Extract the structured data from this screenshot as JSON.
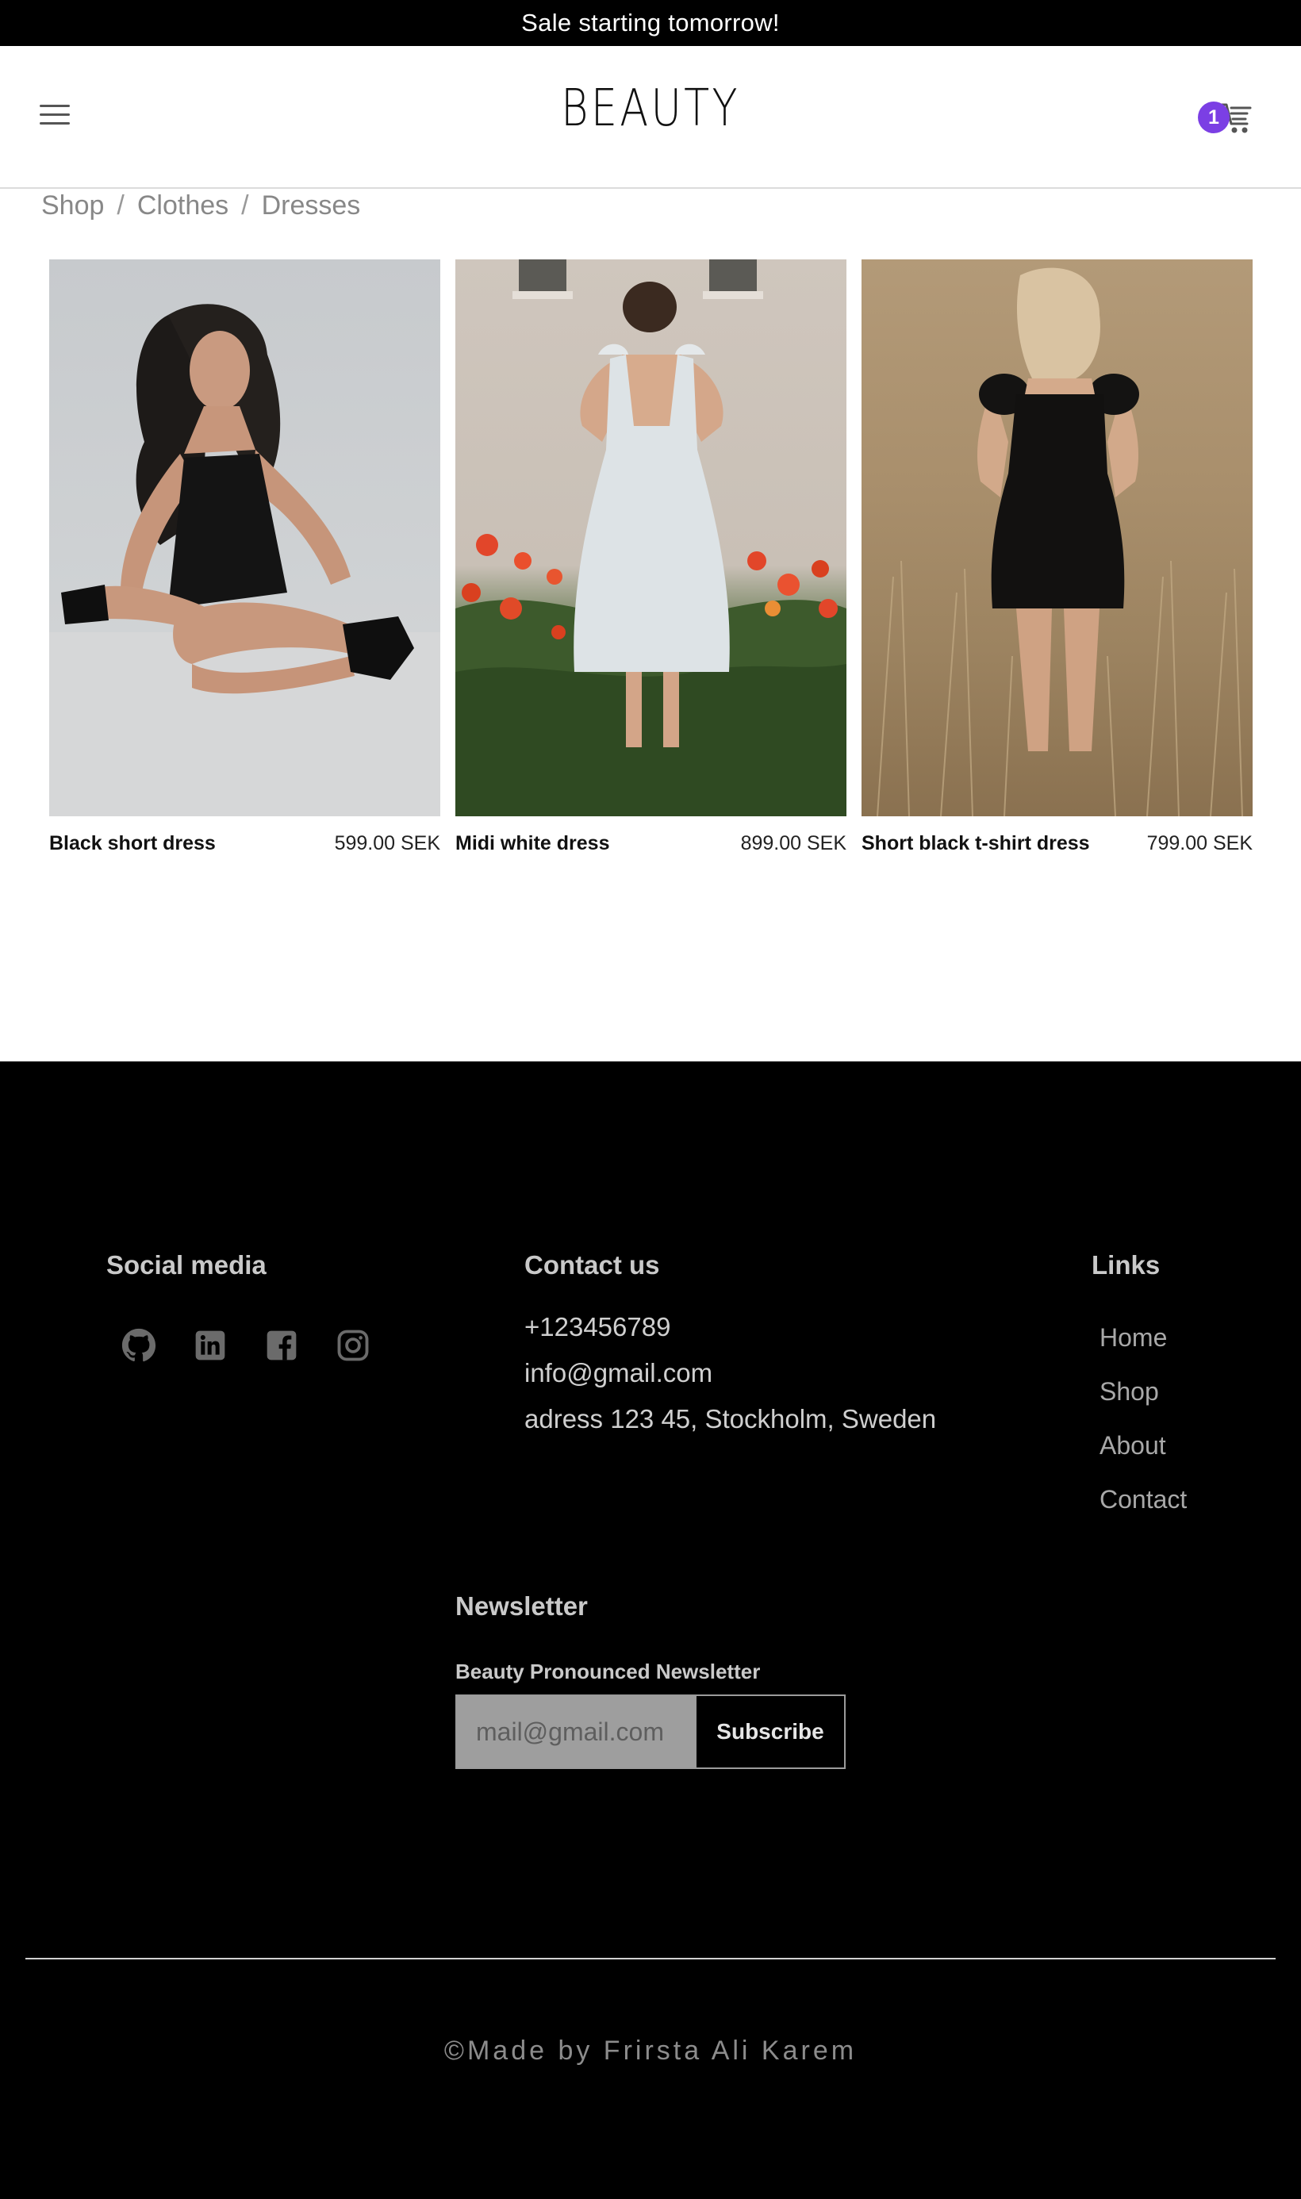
{
  "announcement": "Sale starting tomorrow!",
  "header": {
    "logo": "BEAUTY",
    "cart_count": "1"
  },
  "breadcrumb": [
    "Shop",
    "Clothes",
    "Dresses"
  ],
  "breadcrumb_separator": "/",
  "products": [
    {
      "name": "Black short dress",
      "price": "599.00 SEK"
    },
    {
      "name": "Midi white dress",
      "price": "899.00 SEK"
    },
    {
      "name": "Short black t-shirt dress",
      "price": "799.00 SEK"
    }
  ],
  "footer": {
    "social_heading": "Social media",
    "social_icons": [
      "github-icon",
      "linkedin-icon",
      "facebook-icon",
      "instagram-icon"
    ],
    "contact_heading": "Contact us",
    "contact": {
      "phone": "+123456789",
      "email": "info@gmail.com",
      "address": "adress 123 45, Stockholm, Sweden"
    },
    "links_heading": "Links",
    "links": [
      "Home",
      "Shop",
      "About",
      "Contact"
    ],
    "newsletter_heading": "Newsletter",
    "newsletter_label": "Beauty Pronounced Newsletter",
    "newsletter_placeholder": "mail@gmail.com",
    "subscribe_label": "Subscribe",
    "copyright": "©Made by Frirsta Ali Karem"
  },
  "colors": {
    "badge": "#7b3fe4",
    "footer_bg": "#000000"
  }
}
